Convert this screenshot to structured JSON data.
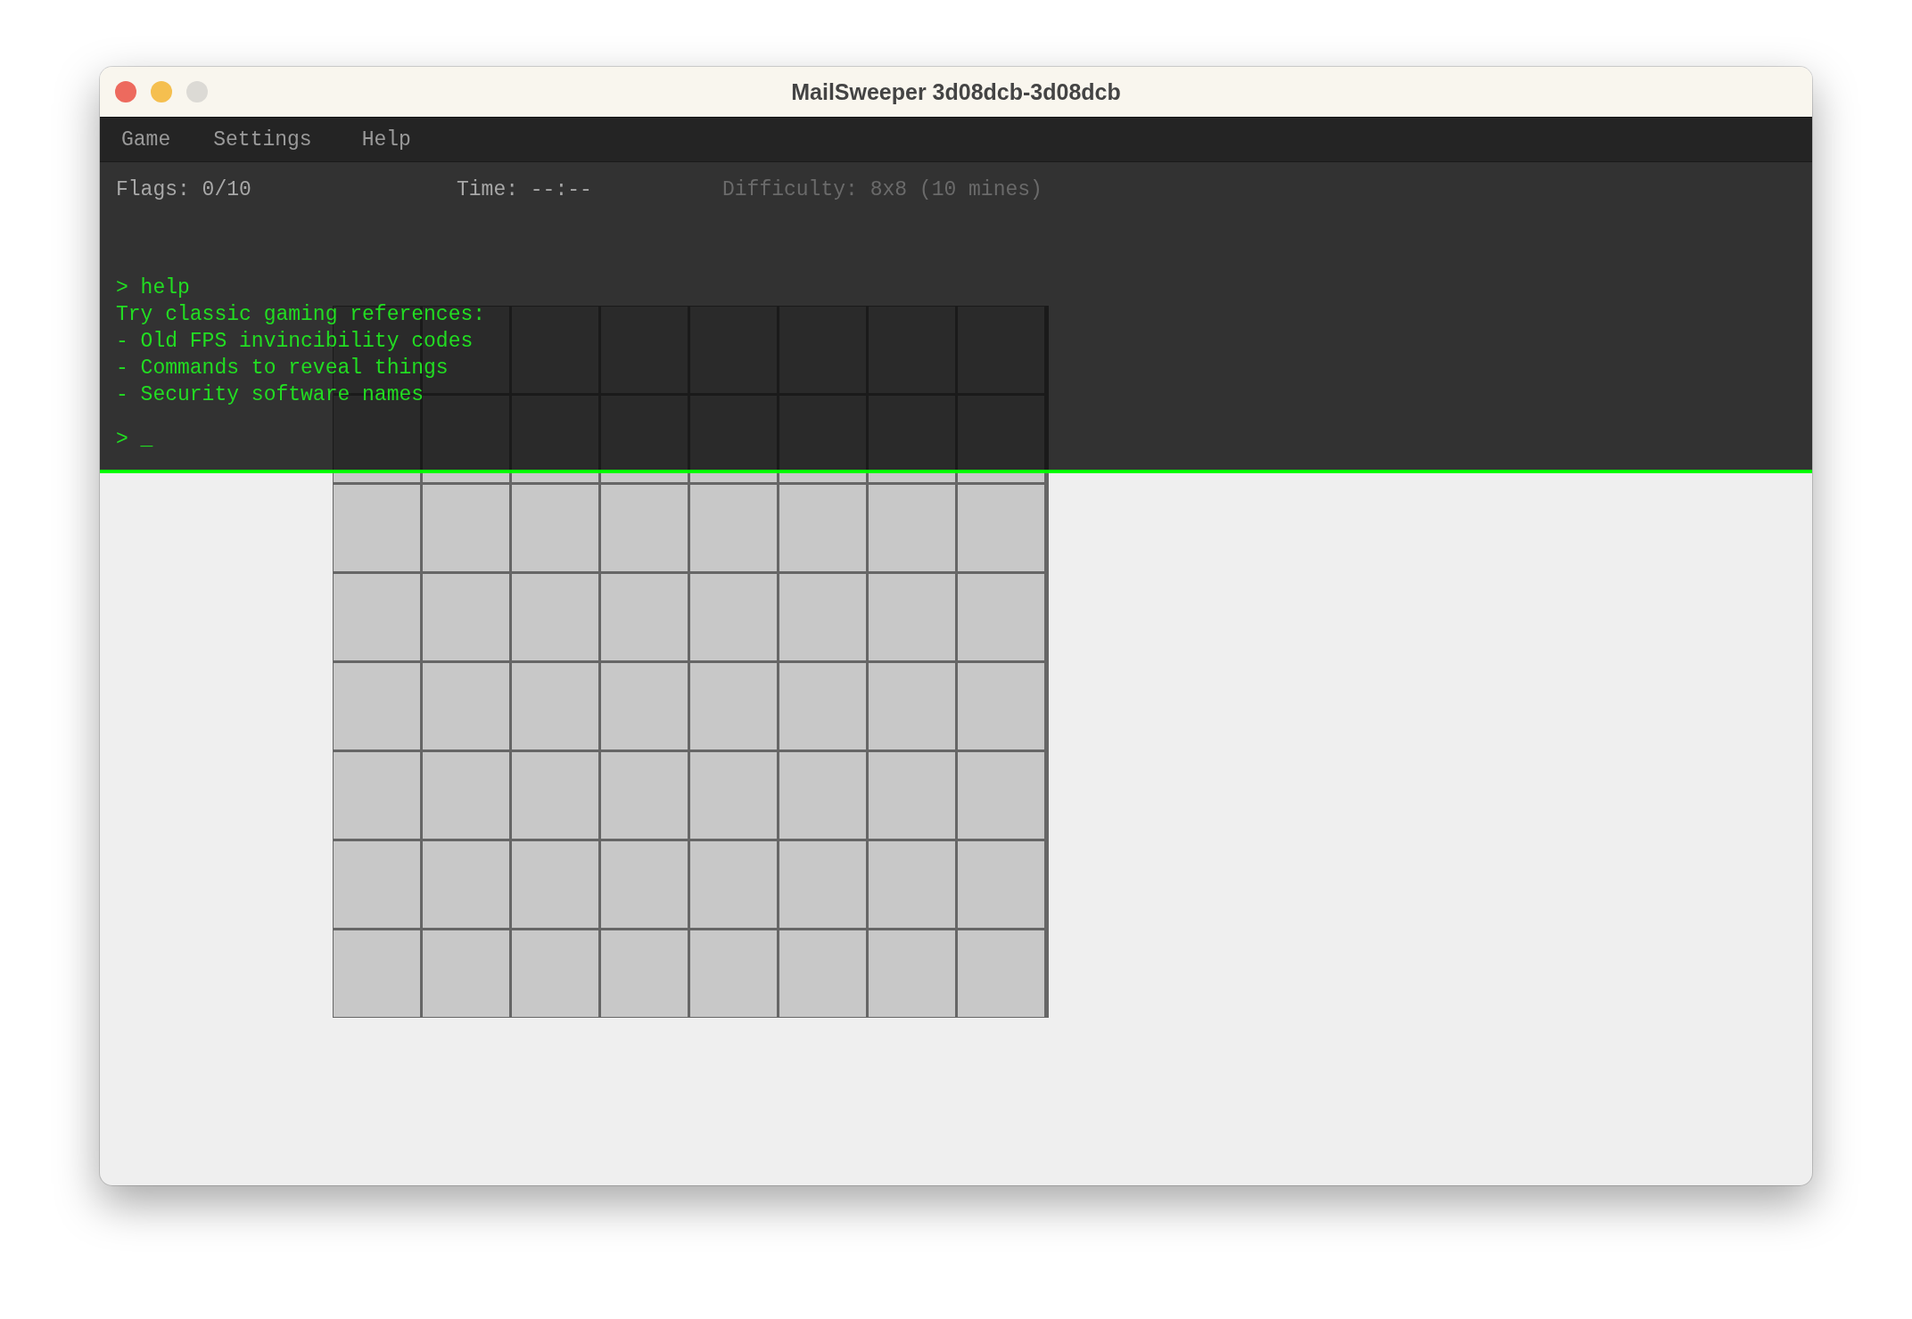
{
  "window": {
    "title": "MailSweeper 3d08dcb-3d08dcb"
  },
  "menu": [
    "Game",
    "Settings",
    "Help"
  ],
  "status": {
    "flags": "Flags: 0/10",
    "time": "Time: --:--",
    "difficulty": "Difficulty: 8x8 (10 mines)"
  },
  "terminal": {
    "lines": [
      "> help",
      "Try classic gaming references:",
      "- Old FPS invincibility codes",
      "- Commands to reveal things",
      "- Security software names"
    ],
    "prompt": "> _"
  }
}
